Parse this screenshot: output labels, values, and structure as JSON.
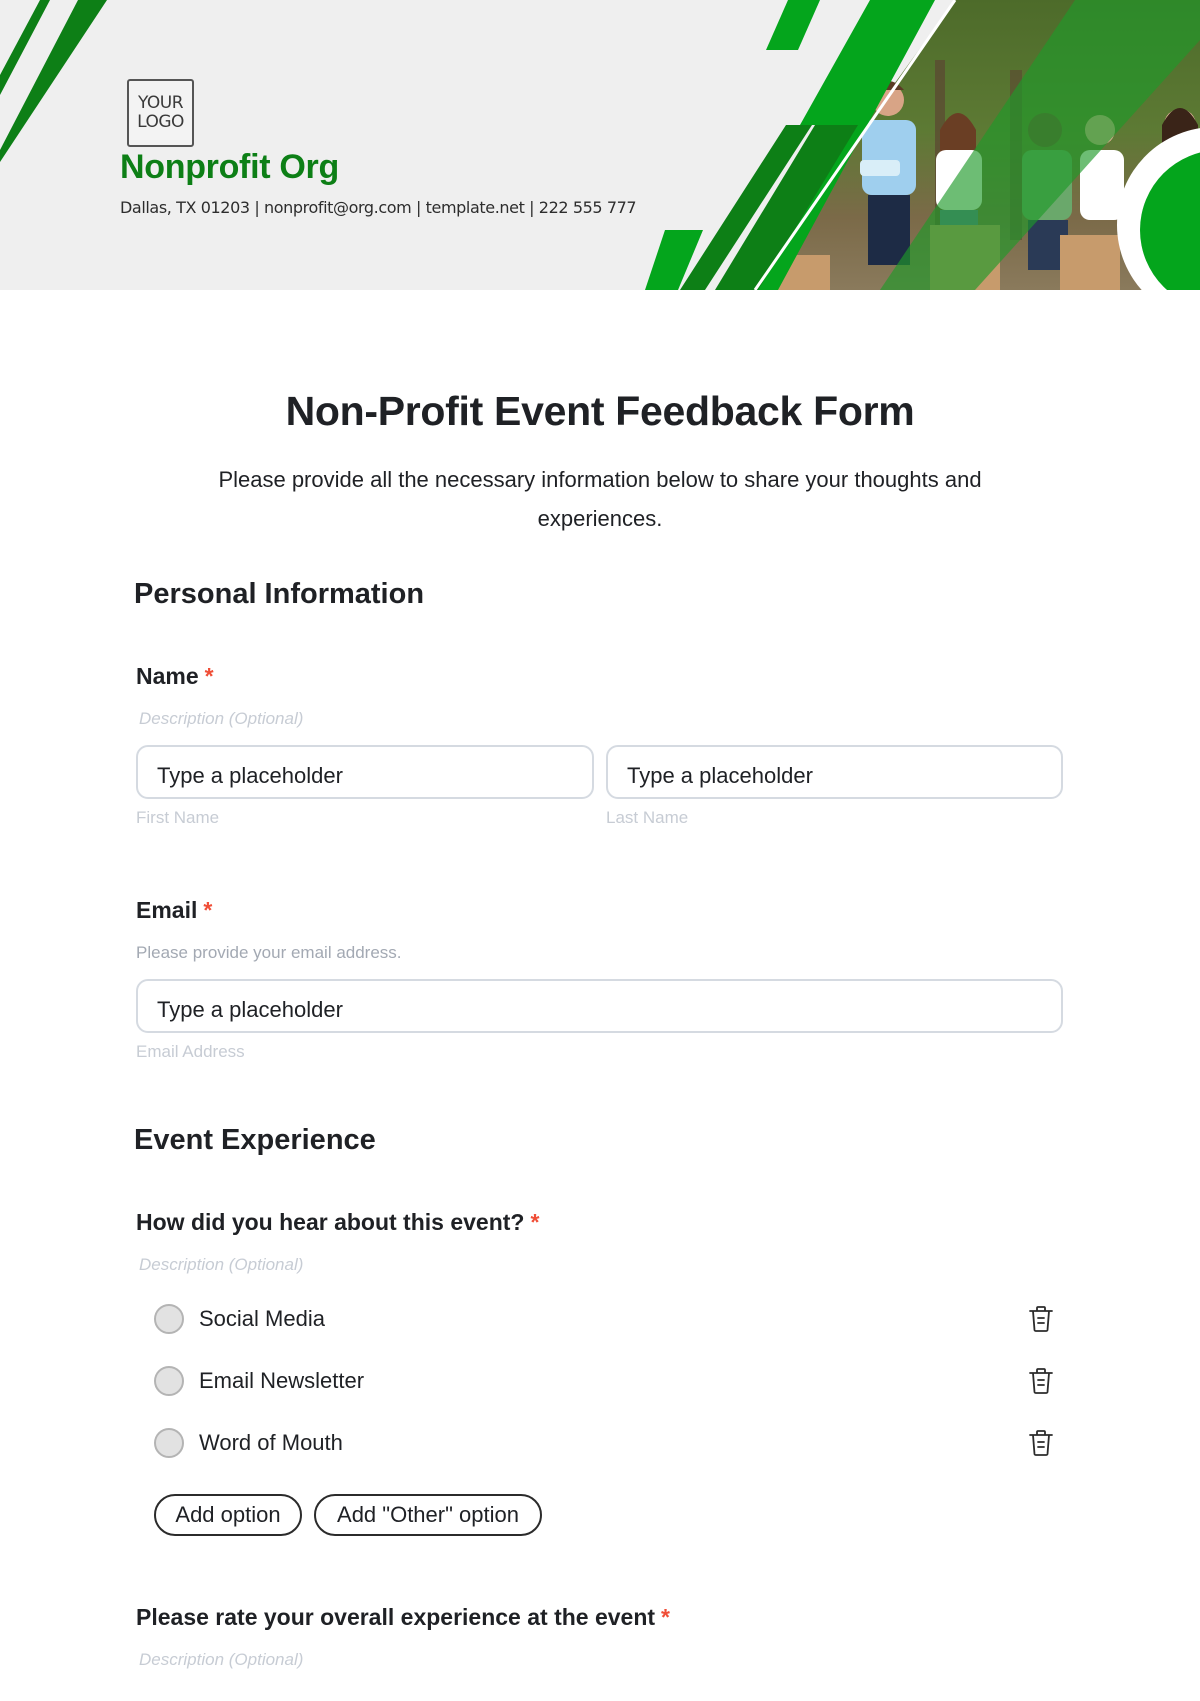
{
  "header": {
    "logo_line1": "YOUR",
    "logo_line2": "LOGO",
    "org_name": "Nonprofit Org",
    "contact": "Dallas, TX 01203 | nonprofit@org.com | template.net | 222 555 777",
    "brand_green": "#0d7f16",
    "accent_green": "#04a51c"
  },
  "form": {
    "title": "Non-Profit Event Feedback Form",
    "description": "Please provide all the necessary information below to share your thoughts and experiences."
  },
  "sections": {
    "personal": {
      "title": "Personal Information",
      "name": {
        "label": "Name",
        "required_mark": "*",
        "description": "Description (Optional)",
        "first": {
          "placeholder": "Type a placeholder",
          "sublabel": "First Name"
        },
        "last": {
          "placeholder": "Type a placeholder",
          "sublabel": "Last Name"
        }
      },
      "email": {
        "label": "Email",
        "required_mark": "*",
        "description": "Please provide your email address.",
        "placeholder": "Type a placeholder",
        "sublabel": "Email Address"
      }
    },
    "experience": {
      "title": "Event Experience",
      "hear_about": {
        "label": "How did you hear about this event?",
        "required_mark": "*",
        "description": "Description (Optional)",
        "options": [
          {
            "label": "Social Media",
            "icon": "trash-icon"
          },
          {
            "label": "Email Newsletter",
            "icon": "trash-icon"
          },
          {
            "label": "Word of Mouth",
            "icon": "trash-icon"
          }
        ],
        "add_option_label": "Add option",
        "add_other_label": "Add \"Other\" option"
      },
      "rating": {
        "label": "Please rate your overall experience at the event",
        "required_mark": "*",
        "description": "Description (Optional)"
      }
    }
  },
  "colors": {
    "required": "#f04e37",
    "muted_text": "#c7ccd4",
    "input_border": "#d5dae1"
  }
}
